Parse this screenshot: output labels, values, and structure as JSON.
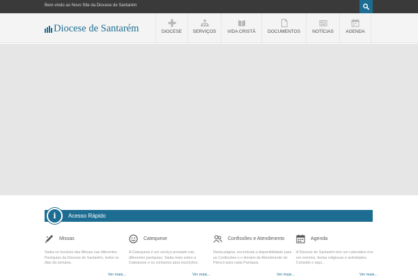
{
  "topbar": {
    "welcome": "Bem-vindo ao Novo Site da Diocese de Santarém"
  },
  "header": {
    "logo_text": "Diocese de Santarém"
  },
  "nav": {
    "items": [
      {
        "label": "DIOCESE",
        "icon": "plus-icon"
      },
      {
        "label": "SERVIÇOS",
        "icon": "sitemap-icon"
      },
      {
        "label": "VIDA CRISTÃ",
        "icon": "book-icon"
      },
      {
        "label": "DOCUMENTOS",
        "icon": "document-icon"
      },
      {
        "label": "NOTÍCIAS",
        "icon": "newspaper-icon"
      },
      {
        "label": "AGENDA",
        "icon": "calendar-icon"
      }
    ]
  },
  "quick_access": {
    "title": "Acesso Rápido",
    "columns": [
      {
        "title": "Missas",
        "icon": "pen-icon",
        "text": "Saiba os horários das Missas nas diferentes Paróquias da Diocese de Santarém, todos os dias da semana.",
        "more": "Ver mais..."
      },
      {
        "title": "Catequese",
        "icon": "smiley-icon",
        "text": "A Catequese é um serviço prestado nas diferentes paróquias. Saiba mais sobre a Catequese e os contactos para inscrições.",
        "more": "Ver mais..."
      },
      {
        "title": "Confissões e Atendimento",
        "icon": "people-icon",
        "text": "Nesta página, encontrará a disponibilidade para as Confissões e o Horário de Atendimento do Pároco para cada Paróquia.",
        "more": "Ver mais..."
      },
      {
        "title": "Agenda",
        "icon": "calendar-icon",
        "text": "A Diocese de Santarém tem um calendário rico em eventos, festas religiosas e actividades. Consulte o aqui...",
        "more": "Ver mais..."
      }
    ]
  },
  "colors": {
    "brand": "#1d6d92",
    "topbar": "#3a3a3a",
    "slider_bg": "#e6e6e6"
  }
}
